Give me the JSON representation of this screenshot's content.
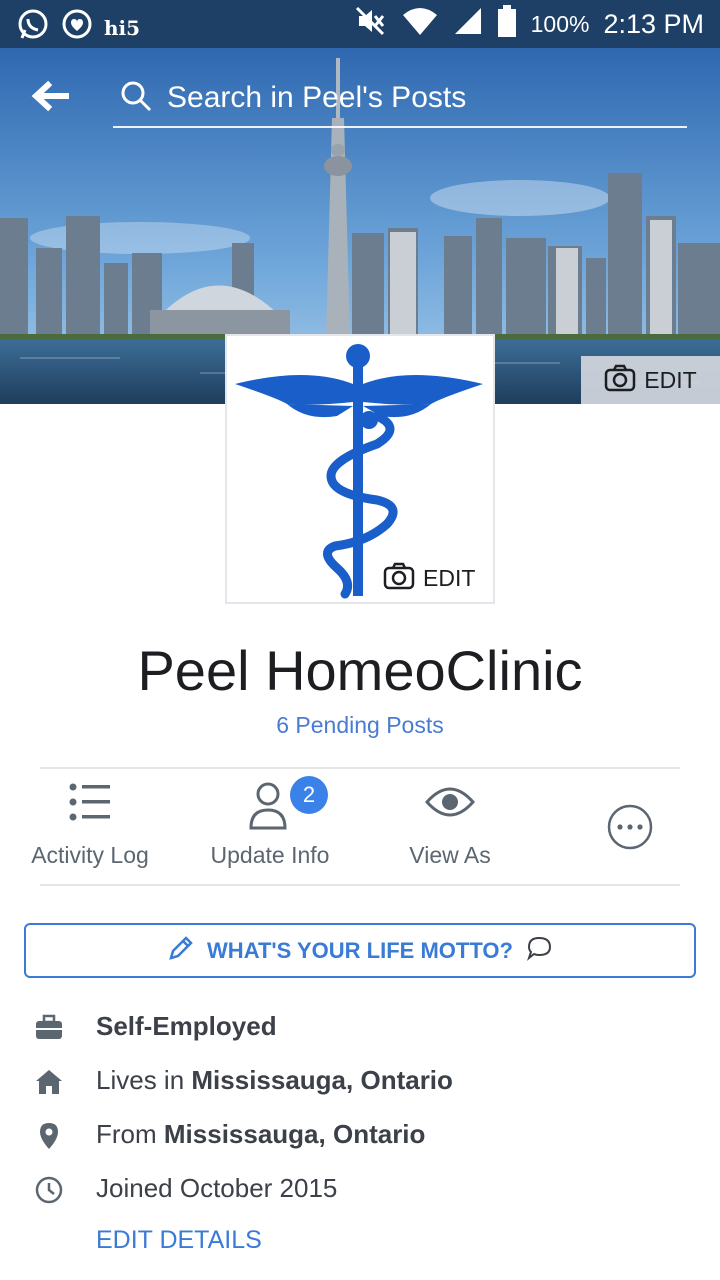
{
  "status_bar": {
    "left_icons": [
      "whatsapp-icon",
      "messenger-icon",
      "hi5-icon"
    ],
    "hi5_label": "hi5",
    "right_icons": [
      "mute-icon",
      "wifi-icon",
      "signal-icon",
      "battery-icon"
    ],
    "battery": "100%",
    "time": "2:13 PM"
  },
  "header": {
    "back_icon": "back-arrow-icon",
    "search_placeholder": "Search in Peel's Posts"
  },
  "cover": {
    "edit_label": "EDIT"
  },
  "profile": {
    "avatar_edit_label": "EDIT",
    "name": "Peel HomeoClinic",
    "pending_posts": "6 Pending Posts"
  },
  "actions": [
    {
      "label": "Activity Log",
      "icon": "list-icon"
    },
    {
      "label": "Update Info",
      "icon": "person-icon",
      "badge": "2"
    },
    {
      "label": "View As",
      "icon": "eye-icon"
    },
    {
      "label": "",
      "icon": "more-icon"
    }
  ],
  "motto": {
    "label": "WHAT'S YOUR LIFE MOTTO?",
    "icon": "pencil-icon"
  },
  "details": {
    "work": {
      "text": "Self-Employed",
      "icon": "briefcase-icon"
    },
    "lives": {
      "prefix": "Lives in ",
      "place": "Mississauga, Ontario",
      "icon": "home-icon"
    },
    "from": {
      "prefix": "From ",
      "place": "Mississauga, Ontario",
      "icon": "location-pin-icon"
    },
    "joined": {
      "text": "Joined October 2015",
      "icon": "clock-icon"
    },
    "edit_label": "EDIT DETAILS"
  },
  "colors": {
    "status_bar": "#1e3f66",
    "accent": "#3a7bd5",
    "badge": "#3b82e8",
    "caduceus": "#1a5fc9"
  }
}
